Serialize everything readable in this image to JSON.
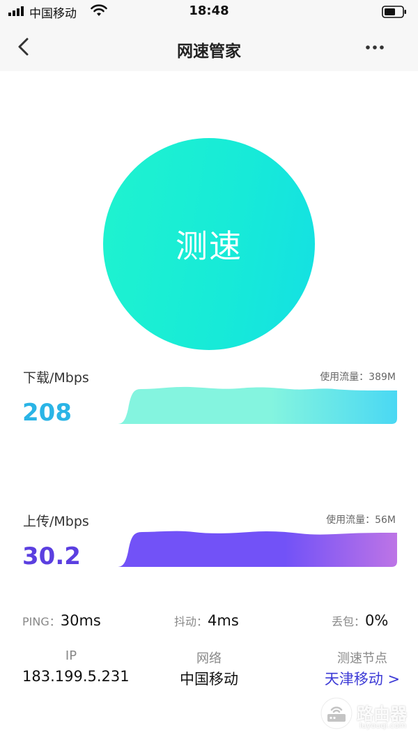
{
  "status_bar": {
    "carrier": "中国移动",
    "time": "18:48"
  },
  "nav": {
    "title": "网速管家"
  },
  "speed_button": {
    "label": "测速"
  },
  "download": {
    "label": "下载/Mbps",
    "usage": "使用流量：389M",
    "value": "208",
    "color": "#2ab4e6",
    "gradient_start": "#84f4df",
    "gradient_end": "#4ad8f3"
  },
  "upload": {
    "label": "上传/Mbps",
    "usage": "使用流量：56M",
    "value": "30.2",
    "color": "#5b3fe0",
    "gradient_start": "#7252f7",
    "gradient_end": "#bd74e6"
  },
  "stats": {
    "ping_label": "PING：",
    "ping_value": "30ms",
    "jitter_label": "抖动：",
    "jitter_value": "4ms",
    "loss_label": "丢包：",
    "loss_value": "0%"
  },
  "info": {
    "ip_label": "IP",
    "ip_value": "183.199.5.231",
    "network_label": "网络",
    "network_value": "中国移动",
    "node_label": "测速节点",
    "node_value": "天津移动 >"
  },
  "watermark": {
    "brand": "路由器",
    "domain": "luyouqi.com"
  }
}
